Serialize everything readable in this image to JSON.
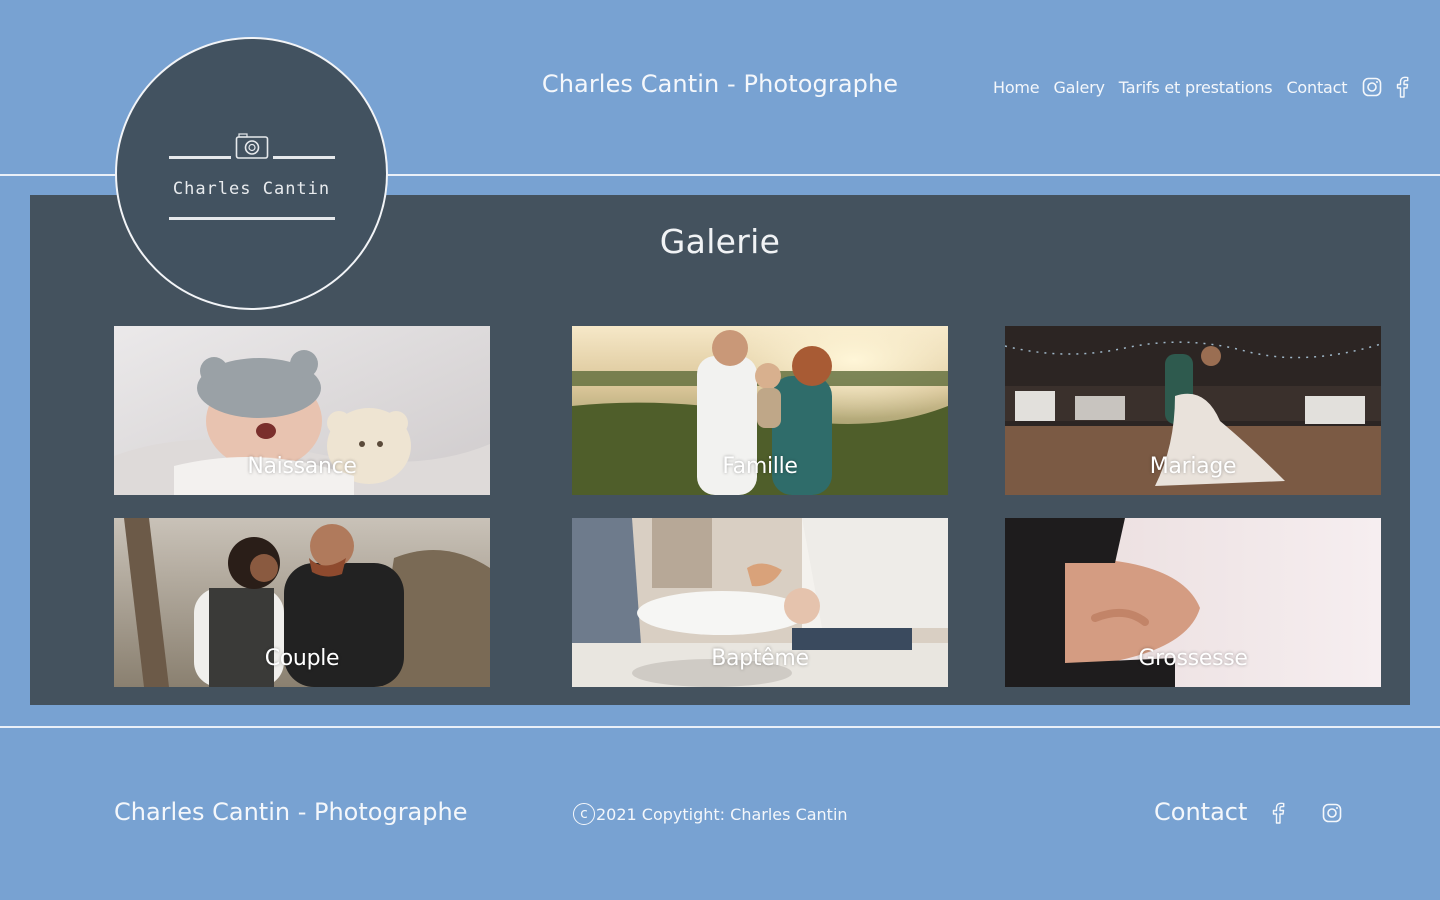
{
  "header": {
    "site_title": "Charles Cantin - Photographe",
    "nav": [
      {
        "label": "Home"
      },
      {
        "label": "Galery"
      },
      {
        "label": "Tarifs et prestations"
      },
      {
        "label": "Contact"
      }
    ],
    "icons": [
      "instagram-icon",
      "facebook-icon"
    ]
  },
  "logo": {
    "text": "Charles Cantin",
    "icon": "camera-icon"
  },
  "gallery": {
    "title": "Galerie",
    "items": [
      {
        "label": "Naissance"
      },
      {
        "label": "Famille"
      },
      {
        "label": "Mariage"
      },
      {
        "label": "Couple"
      },
      {
        "label": "Baptême"
      },
      {
        "label": "Grossesse"
      }
    ]
  },
  "footer": {
    "site_title": "Charles Cantin - Photographe",
    "copyright_symbol": "c",
    "copyright": "2021 Copytight: Charles Cantin",
    "contact": "Contact",
    "icons": [
      "facebook-icon",
      "instagram-icon"
    ]
  },
  "colors": {
    "background": "#78a2d2",
    "panel": "#44525e",
    "text": "#ffffff"
  }
}
